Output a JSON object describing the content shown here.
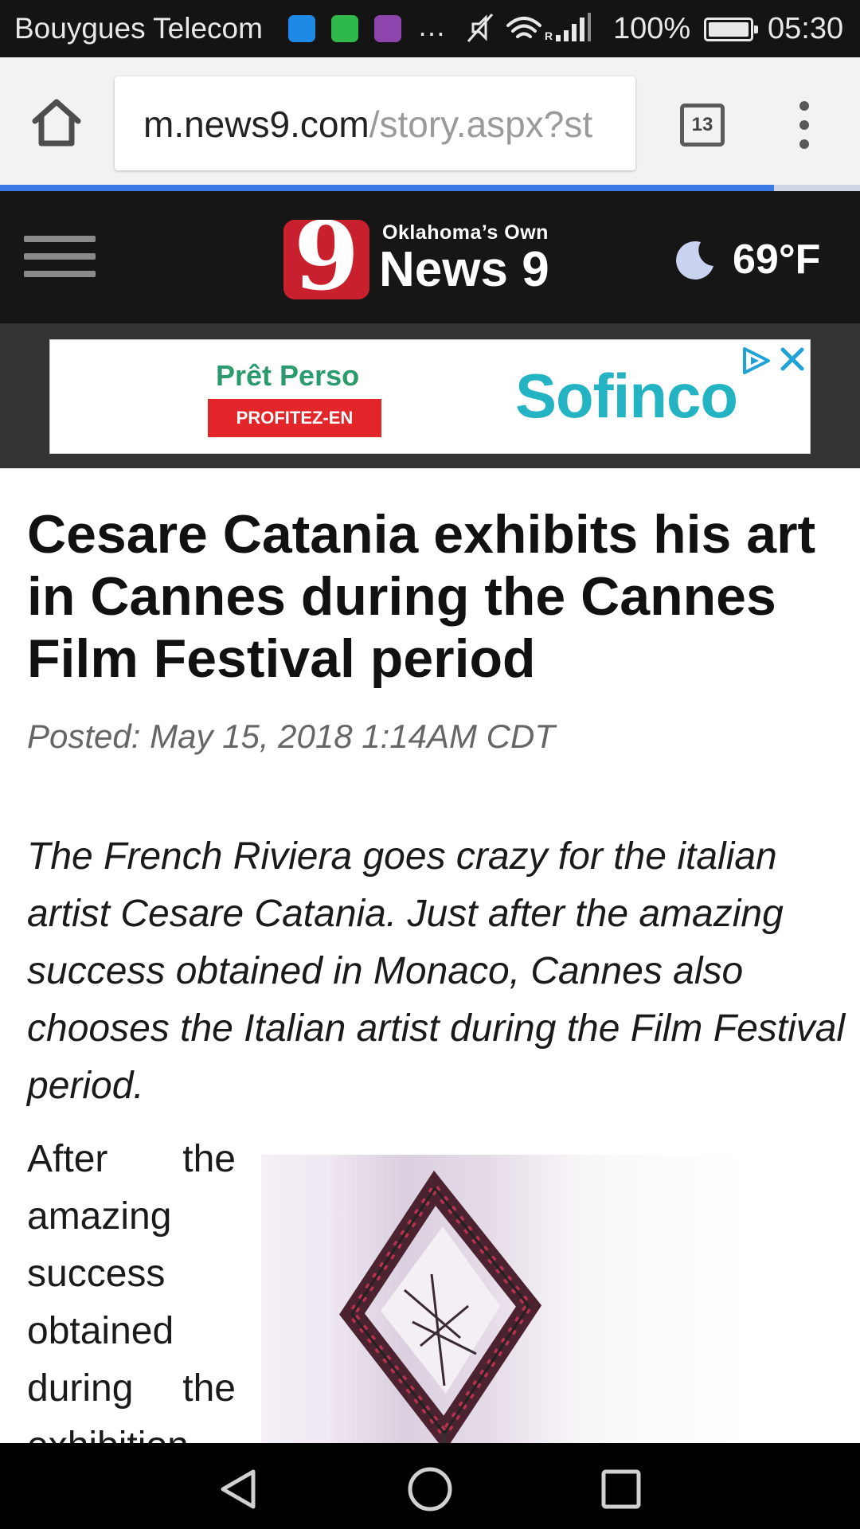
{
  "status_bar": {
    "carrier": "Bouygues Telecom",
    "battery": "100%",
    "time": "05:30",
    "overflow": "…",
    "network_label": "R"
  },
  "browser": {
    "url_host": "m.news9.com",
    "url_path": "/story.aspx?st",
    "tab_count": "13",
    "load_progress": 0.9
  },
  "site": {
    "logo_mark": "9",
    "tagline": "Oklahoma’s Own",
    "brand": "News 9",
    "temperature": "69°F",
    "weather_icon": "moon-icon"
  },
  "ad": {
    "headline": "Prêt Perso",
    "cta": "PROFITEZ-EN",
    "brand": "Sofinco",
    "colors": {
      "brand": "#23b3c2",
      "cta": "#e32629",
      "headline": "#2a9b6d"
    }
  },
  "article": {
    "title": "Cesare Catania exhibits his art in Cannes during the Cannes Film Festival period",
    "posted": "Posted: May 15, 2018 1:14AM CDT",
    "intro": "The French Riviera goes crazy for the italian artist Cesare Catania. Just after the amazing success obtained in Monaco, Cannes also chooses the Italian artist during the Film Festival period.",
    "body": "After the amazing success obtained during the exhibition"
  },
  "colors": {
    "header_bg": "#161616",
    "logo_red": "#c8202c",
    "progress": "#3b7be8"
  }
}
